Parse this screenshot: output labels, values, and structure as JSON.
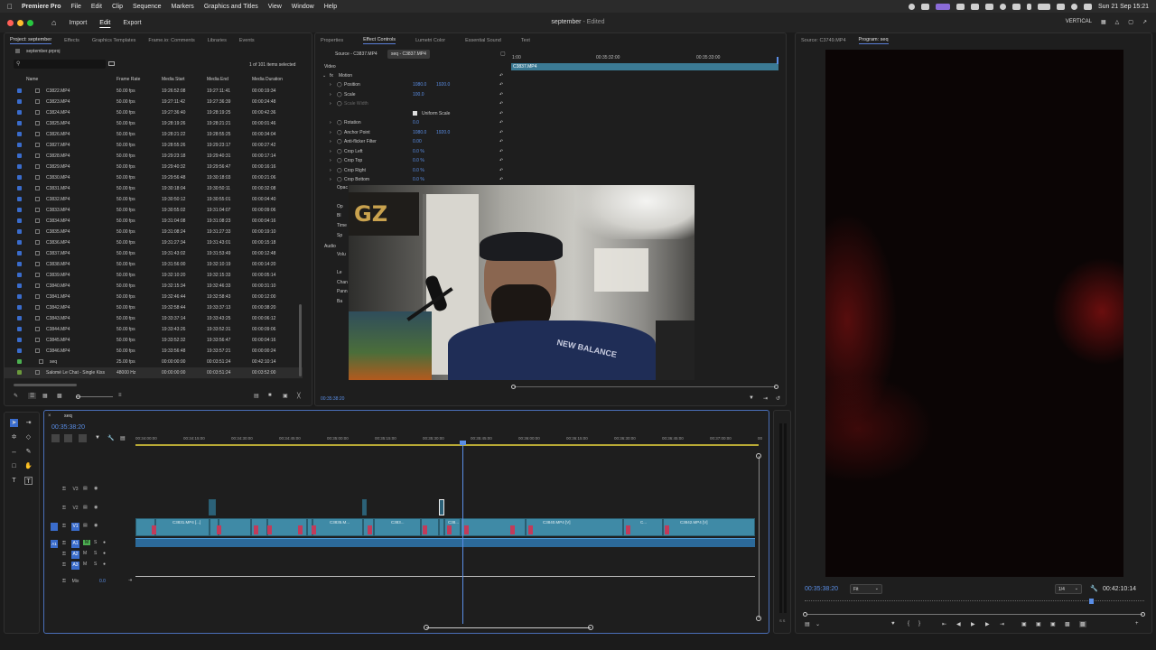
{
  "menubar": {
    "items": [
      "Premiere Pro",
      "File",
      "Edit",
      "Clip",
      "Sequence",
      "Markers",
      "Graphics and Titles",
      "View",
      "Window",
      "Help"
    ],
    "datetime": "Sun 21 Sep  15:21"
  },
  "header": {
    "nav": [
      "Import",
      "Edit",
      "Export"
    ],
    "project_name": "september",
    "edited": " - Edited",
    "workspace": "VERTICAL"
  },
  "project_panel": {
    "tabs": [
      "Project: september",
      "Effects",
      "Graphics Templates",
      "Frame.io: Comments",
      "Libraries",
      "Events"
    ],
    "file": "september.prproj",
    "selection": "1 of 101 items selected",
    "columns": [
      "Name",
      "Frame Rate",
      "Media Start",
      "Media End",
      "Media Duration"
    ],
    "rows": [
      [
        "C3822.MP4",
        "50.00 fps",
        "19:26:52:08",
        "19:27:11:41",
        "00:00:19:34"
      ],
      [
        "C3823.MP4",
        "50.00 fps",
        "19:27:11:42",
        "19:27:36:39",
        "00:00:24:48"
      ],
      [
        "C3824.MP4",
        "50.00 fps",
        "19:27:36:40",
        "19:28:19:25",
        "00:00:42:36"
      ],
      [
        "C3825.MP4",
        "50.00 fps",
        "19:28:19:26",
        "19:28:21:21",
        "00:00:01:46"
      ],
      [
        "C3826.MP4",
        "50.00 fps",
        "19:28:21:22",
        "19:28:55:25",
        "00:00:34:04"
      ],
      [
        "C3827.MP4",
        "50.00 fps",
        "19:28:55:26",
        "19:29:23:17",
        "00:00:27:42"
      ],
      [
        "C3828.MP4",
        "50.00 fps",
        "19:29:23:18",
        "19:29:40:31",
        "00:00:17:14"
      ],
      [
        "C3829.MP4",
        "50.00 fps",
        "19:29:40:32",
        "19:29:56:47",
        "00:00:16:16"
      ],
      [
        "C3830.MP4",
        "50.00 fps",
        "19:29:56:48",
        "19:30:18:03",
        "00:00:21:06"
      ],
      [
        "C3831.MP4",
        "50.00 fps",
        "19:30:18:04",
        "19:30:50:11",
        "00:00:32:08"
      ],
      [
        "C3832.MP4",
        "50.00 fps",
        "19:30:50:12",
        "19:30:55:01",
        "00:00:04:40"
      ],
      [
        "C3833.MP4",
        "50.00 fps",
        "19:30:55:02",
        "19:31:04:07",
        "00:00:09:06"
      ],
      [
        "C3834.MP4",
        "50.00 fps",
        "19:31:04:08",
        "19:31:08:23",
        "00:00:04:16"
      ],
      [
        "C3835.MP4",
        "50.00 fps",
        "19:31:08:24",
        "19:31:27:33",
        "00:00:19:10"
      ],
      [
        "C3836.MP4",
        "50.00 fps",
        "19:31:27:34",
        "19:31:43:01",
        "00:00:15:18"
      ],
      [
        "C3837.MP4",
        "50.00 fps",
        "19:31:43:02",
        "19:31:53:49",
        "00:00:12:48"
      ],
      [
        "C3838.MP4",
        "50.00 fps",
        "19:31:56:00",
        "19:32:10:19",
        "00:00:14:20"
      ],
      [
        "C3839.MP4",
        "50.00 fps",
        "19:32:10:20",
        "19:32:15:33",
        "00:00:05:14"
      ],
      [
        "C3840.MP4",
        "50.00 fps",
        "19:32:15:34",
        "19:32:46:33",
        "00:00:31:10"
      ],
      [
        "C3841.MP4",
        "50.00 fps",
        "19:32:46:44",
        "19:32:58:43",
        "00:00:12:00"
      ],
      [
        "C3842.MP4",
        "50.00 fps",
        "19:32:58:44",
        "19:33:37:13",
        "00:00:38:20"
      ],
      [
        "C3843.MP4",
        "50.00 fps",
        "19:33:37:14",
        "19:33:43:25",
        "00:00:06:12"
      ],
      [
        "C3844.MP4",
        "50.00 fps",
        "19:33:43:26",
        "19:33:52:31",
        "00:00:09:06"
      ],
      [
        "C3845.MP4",
        "50.00 fps",
        "19:33:52:32",
        "19:33:56:47",
        "00:00:04:16"
      ],
      [
        "C3846.MP4",
        "50.00 fps",
        "19:33:56:48",
        "19:33:57:21",
        "00:00:00:24"
      ],
      [
        "seq",
        "25.00 fps",
        "00:00:00:00",
        "00:03:51:24",
        "00:42:10:14"
      ],
      [
        "Salomé Le Chat - Single Kiss",
        "48000 Hz",
        "00:00:00:00",
        "00:03:51:24",
        "00:03:52:00"
      ]
    ]
  },
  "effect_controls": {
    "tabs": [
      "Properties",
      "Effect Controls",
      "Lumetri Color",
      "Essential Sound",
      "Text"
    ],
    "source_tab": "Source - C3837.MP4",
    "seq_tab": "seq - C3837.MP4",
    "clip_label": "C3837.MP4",
    "ruler": [
      "1:00",
      "00:35:32:00",
      "00:35:33:00"
    ],
    "section_video": "Video",
    "section_audio": "Audio",
    "rows": [
      {
        "label": "Motion",
        "v1": "",
        "v2": ""
      },
      {
        "label": "Position",
        "v1": "1080.0",
        "v2": "1920.0"
      },
      {
        "label": "Scale",
        "v1": "100.0",
        "v2": ""
      },
      {
        "label": "Scale Width",
        "v1": "",
        "v2": ""
      },
      {
        "label": "Uniform Scale",
        "v1": "",
        "v2": ""
      },
      {
        "label": "Rotation",
        "v1": "0.0",
        "v2": ""
      },
      {
        "label": "Anchor Point",
        "v1": "1080.0",
        "v2": "1920.0"
      },
      {
        "label": "Anti-flicker Filter",
        "v1": "0.00",
        "v2": ""
      },
      {
        "label": "Crop Left",
        "v1": "0.0 %",
        "v2": ""
      },
      {
        "label": "Crop Top",
        "v1": "0.0 %",
        "v2": ""
      },
      {
        "label": "Crop Right",
        "v1": "0.0 %",
        "v2": ""
      },
      {
        "label": "Crop Bottom",
        "v1": "0.0 %",
        "v2": ""
      }
    ],
    "partial_labels": [
      "Opac",
      "Op",
      "Bl",
      "Time",
      "Sp",
      "Volu",
      "Le",
      "Chan",
      "Pann",
      "Ba"
    ],
    "timecode": "00:35:38:20"
  },
  "program_panel": {
    "source_tab": "Source: C3749.MP4",
    "program_tab": "Program: seq",
    "timecode": "00:35:38:20",
    "fit": "Fit",
    "quality": "1/4",
    "duration": "00:42:10:14"
  },
  "timeline": {
    "sequence": "seq",
    "timecode": "00:35:38:20",
    "ruler": [
      "00:34:00:00",
      "00:34:15:00",
      "00:34:30:00",
      "00:34:45:00",
      "00:35:00:00",
      "00:35:15:00",
      "00:35:30:00",
      "00:35:45:00",
      "00:36:00:00",
      "00:36:15:00",
      "00:36:30:00",
      "00:36:45:00",
      "00:37:00:00",
      "00"
    ],
    "tracks": [
      "V3",
      "V2",
      "V1",
      "A1",
      "A2",
      "A3",
      "Mix"
    ],
    "mix_value": "0.0",
    "clips": [
      "C3831.MP4 [...]",
      "C3835.M...",
      "C383...",
      "C38...",
      "C3840.MP4 [V]",
      "C...",
      "C3842.MP4 [V]"
    ]
  },
  "colors": {
    "accent": "#5a8ee6",
    "clip": "#3f8aa6",
    "playhead": "#5a8ee6",
    "marker": "#c23b5a"
  }
}
